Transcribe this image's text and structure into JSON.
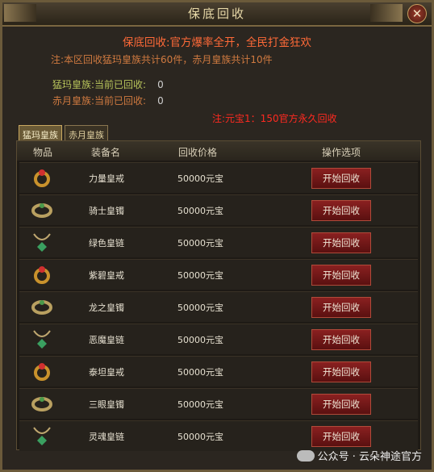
{
  "window": {
    "title": "保底回收"
  },
  "notice": {
    "headline": "保底回收:官方爆率全开，全民打金狂欢",
    "note": "注:本区回收猛玛皇族共计60件，赤月皇族共计10件",
    "mengma_label": "猛玛皇族:当前已回收:",
    "mengma_count": "0",
    "chiyue_label": "赤月皇族:当前已回收:",
    "chiyue_count": "0",
    "rate": "注:元宝1：150官方永久回收"
  },
  "tabs": [
    "猛玛皇族",
    "赤月皇族"
  ],
  "columns": [
    "物品",
    "装备名",
    "回收价格",
    "操作选项"
  ],
  "rows": [
    {
      "name": "力量皇戒",
      "price": "50000元宝",
      "action": "开始回收",
      "icon": "ring-icon"
    },
    {
      "name": "骑士皇镯",
      "price": "50000元宝",
      "action": "开始回收",
      "icon": "bracelet-icon"
    },
    {
      "name": "绿色皇链",
      "price": "50000元宝",
      "action": "开始回收",
      "icon": "necklace-icon"
    },
    {
      "name": "紫碧皇戒",
      "price": "50000元宝",
      "action": "开始回收",
      "icon": "ring-icon"
    },
    {
      "name": "龙之皇镯",
      "price": "50000元宝",
      "action": "开始回收",
      "icon": "bracelet-icon"
    },
    {
      "name": "恶魔皇链",
      "price": "50000元宝",
      "action": "开始回收",
      "icon": "necklace-icon"
    },
    {
      "name": "泰坦皇戒",
      "price": "50000元宝",
      "action": "开始回收",
      "icon": "ring-icon"
    },
    {
      "name": "三眼皇镯",
      "price": "50000元宝",
      "action": "开始回收",
      "icon": "bracelet-icon"
    },
    {
      "name": "灵魂皇链",
      "price": "50000元宝",
      "action": "开始回收",
      "icon": "necklace-icon"
    }
  ],
  "watermark": "公众号 · 云朵神途官方",
  "colors": {
    "accent": "#ff6a38",
    "button": "#8a2020",
    "gold": "#c9a860"
  }
}
